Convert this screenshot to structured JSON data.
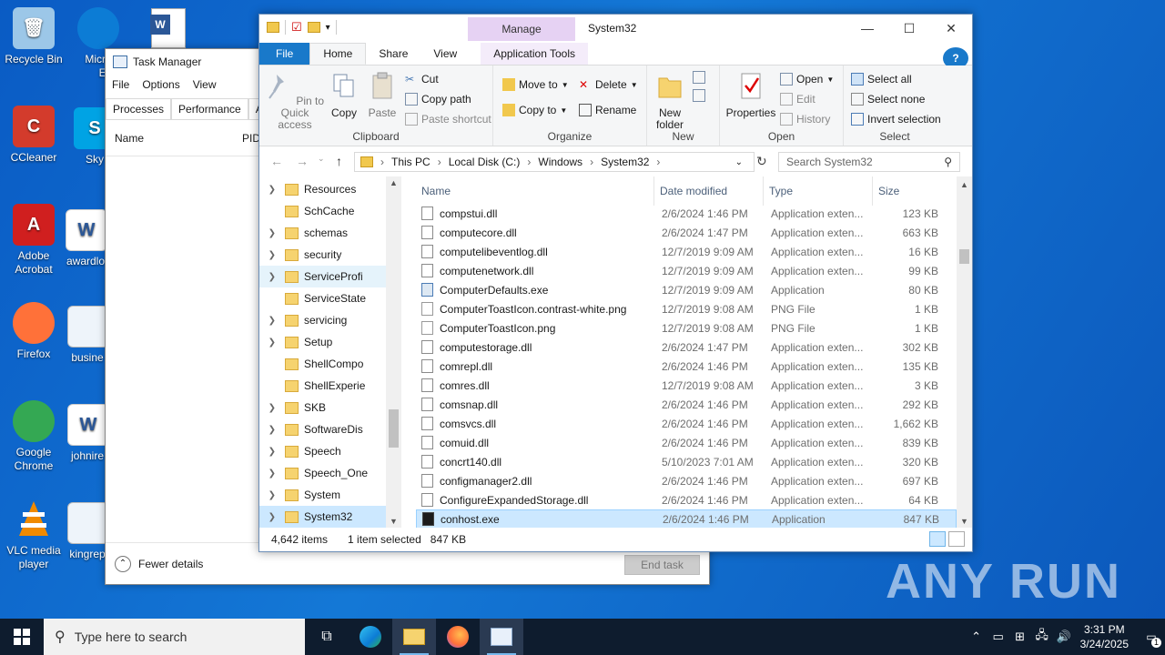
{
  "desktop": {
    "icons": [
      {
        "label": "Recycle Bin",
        "color": "#9cc7e8"
      },
      {
        "label": "CCleaner",
        "color": "#d33b2c"
      },
      {
        "label": "Adobe Acrobat",
        "color": "#d01f1f"
      },
      {
        "label": "Firefox",
        "color": "#ff7139"
      },
      {
        "label": "Google Chrome",
        "color": "#34a853"
      },
      {
        "label": "VLC media player",
        "color": "#f08a00"
      }
    ],
    "partial_icons": [
      "Micro",
      "Ed",
      "Sky",
      "awardlo",
      "busine",
      "johnire",
      "kingrep"
    ],
    "watermark": "ANY RUN"
  },
  "task_manager": {
    "title": "Task Manager",
    "menu": [
      "File",
      "Options",
      "View"
    ],
    "tabs": [
      "Processes",
      "Performance",
      "App"
    ],
    "columns": [
      "Name",
      "PID"
    ],
    "fewer_details": "Fewer details",
    "end_task": "End task"
  },
  "explorer": {
    "caption": "System32",
    "manage_tab": "Manage",
    "tabs": {
      "file": "File",
      "home": "Home",
      "share": "Share",
      "view": "View",
      "app_tools": "Application Tools"
    },
    "ribbon": {
      "clipboard": {
        "label": "Clipboard",
        "pin": "Pin to Quick access",
        "copy": "Copy",
        "paste": "Paste",
        "cut": "Cut",
        "copy_path": "Copy path",
        "paste_shortcut": "Paste shortcut"
      },
      "organize": {
        "label": "Organize",
        "move_to": "Move to",
        "copy_to": "Copy to",
        "delete": "Delete",
        "rename": "Rename"
      },
      "new": {
        "label": "New",
        "new_folder": "New folder"
      },
      "open": {
        "label": "Open",
        "properties": "Properties",
        "open": "Open",
        "edit": "Edit",
        "history": "History"
      },
      "select": {
        "label": "Select",
        "select_all": "Select all",
        "select_none": "Select none",
        "invert": "Invert selection"
      }
    },
    "breadcrumb": [
      "This PC",
      "Local Disk (C:)",
      "Windows",
      "System32"
    ],
    "search_placeholder": "Search System32",
    "tree": [
      {
        "name": "Resources",
        "exp": true
      },
      {
        "name": "SchCache",
        "exp": false
      },
      {
        "name": "schemas",
        "exp": true
      },
      {
        "name": "security",
        "exp": true
      },
      {
        "name": "ServiceProfi",
        "exp": true,
        "state": "hl"
      },
      {
        "name": "ServiceState",
        "exp": false
      },
      {
        "name": "servicing",
        "exp": true
      },
      {
        "name": "Setup",
        "exp": true
      },
      {
        "name": "ShellCompo",
        "exp": false
      },
      {
        "name": "ShellExperie",
        "exp": false
      },
      {
        "name": "SKB",
        "exp": true
      },
      {
        "name": "SoftwareDis",
        "exp": true
      },
      {
        "name": "Speech",
        "exp": true
      },
      {
        "name": "Speech_One",
        "exp": true
      },
      {
        "name": "System",
        "exp": true
      },
      {
        "name": "System32",
        "exp": true,
        "state": "sel"
      }
    ],
    "columns": [
      "Name",
      "Date modified",
      "Type",
      "Size"
    ],
    "files": [
      {
        "name": "compstui.dll",
        "date": "2/6/2024 1:46 PM",
        "type": "Application exten...",
        "size": "123 KB",
        "kind": "dll"
      },
      {
        "name": "computecore.dll",
        "date": "2/6/2024 1:47 PM",
        "type": "Application exten...",
        "size": "663 KB",
        "kind": "dll"
      },
      {
        "name": "computelibeventlog.dll",
        "date": "12/7/2019 9:09 AM",
        "type": "Application exten...",
        "size": "16 KB",
        "kind": "dll"
      },
      {
        "name": "computenetwork.dll",
        "date": "12/7/2019 9:09 AM",
        "type": "Application exten...",
        "size": "99 KB",
        "kind": "dll"
      },
      {
        "name": "ComputerDefaults.exe",
        "date": "12/7/2019 9:09 AM",
        "type": "Application",
        "size": "80 KB",
        "kind": "app"
      },
      {
        "name": "ComputerToastIcon.contrast-white.png",
        "date": "12/7/2019 9:08 AM",
        "type": "PNG File",
        "size": "1 KB",
        "kind": "png"
      },
      {
        "name": "ComputerToastIcon.png",
        "date": "12/7/2019 9:08 AM",
        "type": "PNG File",
        "size": "1 KB",
        "kind": "png"
      },
      {
        "name": "computestorage.dll",
        "date": "2/6/2024 1:47 PM",
        "type": "Application exten...",
        "size": "302 KB",
        "kind": "dll"
      },
      {
        "name": "comrepl.dll",
        "date": "2/6/2024 1:46 PM",
        "type": "Application exten...",
        "size": "135 KB",
        "kind": "dll"
      },
      {
        "name": "comres.dll",
        "date": "12/7/2019 9:08 AM",
        "type": "Application exten...",
        "size": "3 KB",
        "kind": "dll"
      },
      {
        "name": "comsnap.dll",
        "date": "2/6/2024 1:46 PM",
        "type": "Application exten...",
        "size": "292 KB",
        "kind": "dll"
      },
      {
        "name": "comsvcs.dll",
        "date": "2/6/2024 1:46 PM",
        "type": "Application exten...",
        "size": "1,662 KB",
        "kind": "dll"
      },
      {
        "name": "comuid.dll",
        "date": "2/6/2024 1:46 PM",
        "type": "Application exten...",
        "size": "839 KB",
        "kind": "dll"
      },
      {
        "name": "concrt140.dll",
        "date": "5/10/2023 7:01 AM",
        "type": "Application exten...",
        "size": "320 KB",
        "kind": "dll"
      },
      {
        "name": "configmanager2.dll",
        "date": "2/6/2024 1:46 PM",
        "type": "Application exten...",
        "size": "697 KB",
        "kind": "dll"
      },
      {
        "name": "ConfigureExpandedStorage.dll",
        "date": "2/6/2024 1:46 PM",
        "type": "Application exten...",
        "size": "64 KB",
        "kind": "dll"
      },
      {
        "name": "conhost.exe",
        "date": "2/6/2024 1:46 PM",
        "type": "Application",
        "size": "847 KB",
        "kind": "exe",
        "selected": true
      }
    ],
    "status": {
      "count": "4,642 items",
      "selected": "1 item selected",
      "size": "847 KB"
    }
  },
  "taskbar": {
    "search_placeholder": "Type here to search",
    "time": "3:31 PM",
    "date": "3/24/2025",
    "notification_count": "1"
  }
}
